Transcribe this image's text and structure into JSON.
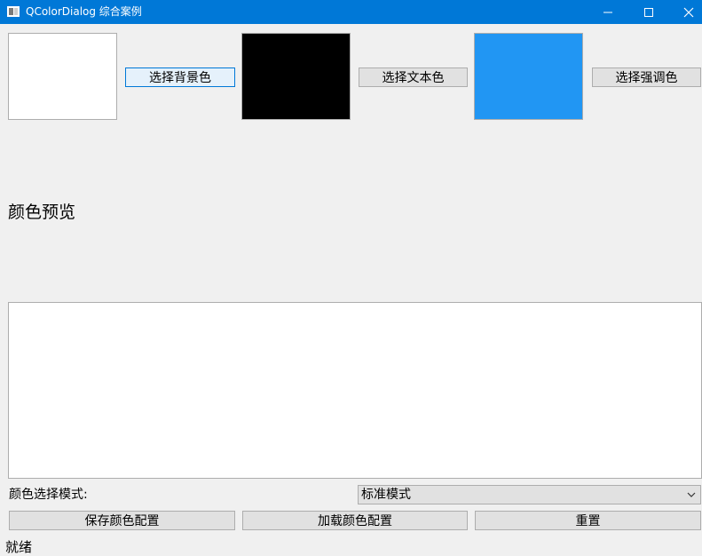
{
  "window": {
    "title": "QColorDialog 综合案例",
    "controls": [
      "minimize-icon",
      "maximize-icon",
      "close-icon"
    ]
  },
  "swatches": {
    "background": {
      "color": "#ffffff",
      "button_label": "选择背景色"
    },
    "text": {
      "color": "#000000",
      "button_label": "选择文本色"
    },
    "accent": {
      "color": "#2196f3",
      "button_label": "选择强调色"
    }
  },
  "preview": {
    "label": "颜色预览",
    "background_color": "#ffffff"
  },
  "mode": {
    "label": "颜色选择模式:",
    "selected": "标准模式"
  },
  "actions": {
    "save_label": "保存颜色配置",
    "load_label": "加载颜色配置",
    "reset_label": "重置"
  },
  "status": {
    "text": "就绪"
  }
}
